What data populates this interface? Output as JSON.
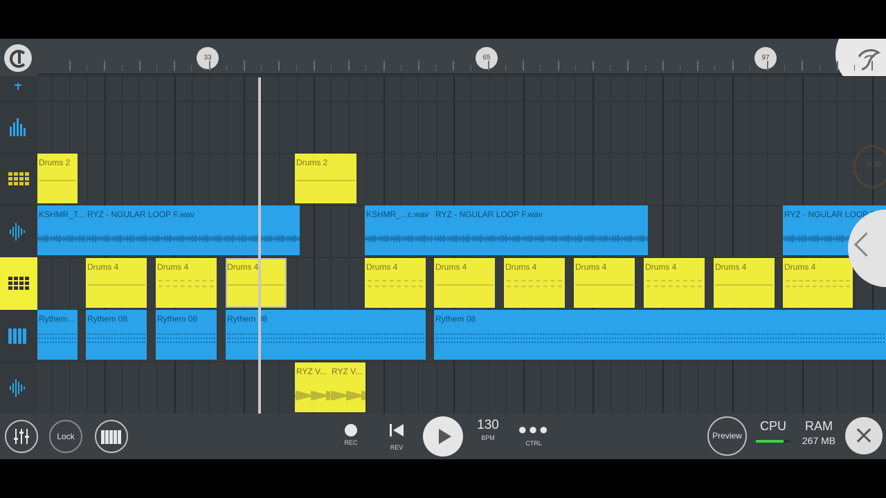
{
  "ruler": {
    "markers": [
      "33",
      "65",
      "97"
    ]
  },
  "tracks": [
    {
      "icon": "partial-track-icon"
    },
    {
      "icon": "equalizer-track-icon"
    },
    {
      "icon": "drum-pattern-track-icon"
    },
    {
      "icon": "audio-waveform-track-icon"
    },
    {
      "icon": "drum-pattern-track-icon",
      "selected": true
    },
    {
      "icon": "piano-roll-track-icon"
    },
    {
      "icon": "audio-waveform-track-icon"
    }
  ],
  "clips": [
    {
      "label": "Drums 2",
      "color": "yellow"
    },
    {
      "label": "Drums 2",
      "color": "yellow"
    },
    {
      "label": "KSHMR_T...",
      "color": "blue"
    },
    {
      "label": "RYZ - NGULAR LOOP F.wav",
      "color": "blue"
    },
    {
      "label": "KSHMR_...c.wav",
      "color": "blue"
    },
    {
      "label": "RYZ - NGULAR LOOP F.wav",
      "color": "blue"
    },
    {
      "label": "RYZ - NGULAR LOOP F...",
      "color": "blue"
    },
    {
      "label": "Drums 4",
      "color": "yellow"
    },
    {
      "label": "Drums 4",
      "color": "yellow"
    },
    {
      "label": "Drums 4",
      "color": "yellow",
      "selected": true
    },
    {
      "label": "Drums 4",
      "color": "yellow"
    },
    {
      "label": "Drums 4",
      "color": "yellow"
    },
    {
      "label": "Drums 4",
      "color": "yellow"
    },
    {
      "label": "Drums 4",
      "color": "yellow"
    },
    {
      "label": "Drums 4",
      "color": "yellow"
    },
    {
      "label": "Drums 4",
      "color": "yellow"
    },
    {
      "label": "Drums 4",
      "color": "yellow"
    },
    {
      "label": "Rythem...",
      "color": "blue"
    },
    {
      "label": "Rythem 08",
      "color": "blue"
    },
    {
      "label": "Rythem 08",
      "color": "blue"
    },
    {
      "label": "Rythem 08",
      "color": "blue"
    },
    {
      "label": "Rythem 08",
      "color": "blue"
    },
    {
      "label": "RYZ V...",
      "color": "yellow"
    },
    {
      "label": "RYZ V...",
      "color": "yellow"
    }
  ],
  "overlay": {
    "timer": "01:10"
  },
  "transport": {
    "lock": "Lock",
    "rec": "REC",
    "rev": "REV",
    "bpm": "130",
    "bpm_caption": "BPM",
    "ctrl": "CTRL",
    "preview": "Preview",
    "cpu": "CPU",
    "cpu_level": 0.8,
    "ram": "RAM",
    "ram_value": "267 MB"
  },
  "colors": {
    "clip_yellow": "#f0ec3c",
    "clip_blue": "#2ba3ea",
    "background": "#353b3f"
  }
}
